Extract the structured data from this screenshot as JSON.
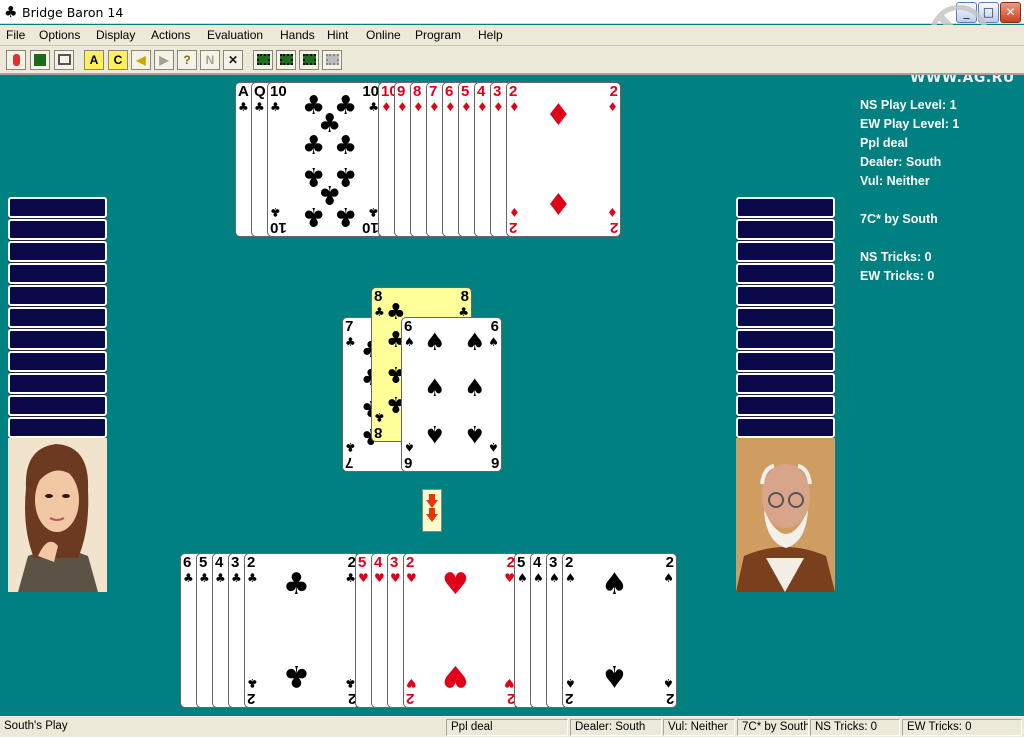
{
  "window": {
    "title": "Bridge Baron 14",
    "icon": "club-icon"
  },
  "watermark": "WWW.AG.RU",
  "menu": [
    "File",
    "Options",
    "Display",
    "Actions",
    "Evaluation",
    "Hands",
    "Hint",
    "Online",
    "Program",
    "Help"
  ],
  "toolbar": [
    {
      "icon": "stop-icon",
      "label": "",
      "enabled": true
    },
    {
      "icon": "dice-icon",
      "label": "",
      "enabled": true
    },
    {
      "icon": "book-icon",
      "label": "",
      "enabled": true
    },
    {
      "icon": "a-icon",
      "label": "A",
      "enabled": true
    },
    {
      "icon": "c-icon",
      "label": "C",
      "enabled": true
    },
    {
      "icon": "back-icon",
      "label": "◀",
      "enabled": true
    },
    {
      "icon": "forward-icon",
      "label": "▶",
      "enabled": false
    },
    {
      "icon": "hint-icon",
      "label": "?",
      "enabled": true
    },
    {
      "icon": "n-icon",
      "label": "N",
      "enabled": false
    },
    {
      "icon": "x-icon",
      "label": "✕",
      "enabled": true
    },
    {
      "icon": "film-icon",
      "label": "",
      "enabled": true
    },
    {
      "icon": "film-icon",
      "label": "",
      "enabled": true
    },
    {
      "icon": "film-icon",
      "label": "",
      "enabled": true
    },
    {
      "icon": "film-icon",
      "label": "",
      "enabled": false
    }
  ],
  "info": {
    "ns_play_level": "NS Play Level: 1",
    "ew_play_level": "EW Play Level: 1",
    "deal": "Ppl deal",
    "dealer": "Dealer: South",
    "vul": "Vul: Neither",
    "contract": "7C* by South",
    "ns_tricks": "NS Tricks: 0",
    "ew_tricks": "EW Tricks: 0"
  },
  "north": {
    "clubs": [
      "A",
      "Q",
      "10"
    ],
    "diamonds": [
      "10",
      "9",
      "8",
      "7",
      "6",
      "5",
      "4",
      "3",
      "2"
    ]
  },
  "south": {
    "clubs": [
      "6",
      "5",
      "4",
      "3",
      "2"
    ],
    "hearts": [
      "5",
      "4",
      "3",
      "2"
    ],
    "spades": [
      "5",
      "4",
      "3",
      "2"
    ]
  },
  "trick": [
    {
      "rank": "7",
      "suit": "♣",
      "color": "black",
      "highlight": false
    },
    {
      "rank": "8",
      "suit": "♣",
      "color": "black",
      "highlight": true
    },
    {
      "rank": "6",
      "suit": "♠",
      "color": "black",
      "highlight": false
    }
  ],
  "status": {
    "message": "South's Play",
    "deal": "Ppl deal",
    "dealer": "Dealer: South",
    "vul": "Vul: Neither",
    "contract": "7C* by South",
    "ns_tricks": "NS Tricks: 0",
    "ew_tricks": "EW Tricks: 0"
  },
  "west_backs": 11,
  "east_backs": 11,
  "colors": {
    "table": "#008080",
    "card_back": "#0a0a4a",
    "highlight": "#ffff9a",
    "red": "#e0001a"
  }
}
